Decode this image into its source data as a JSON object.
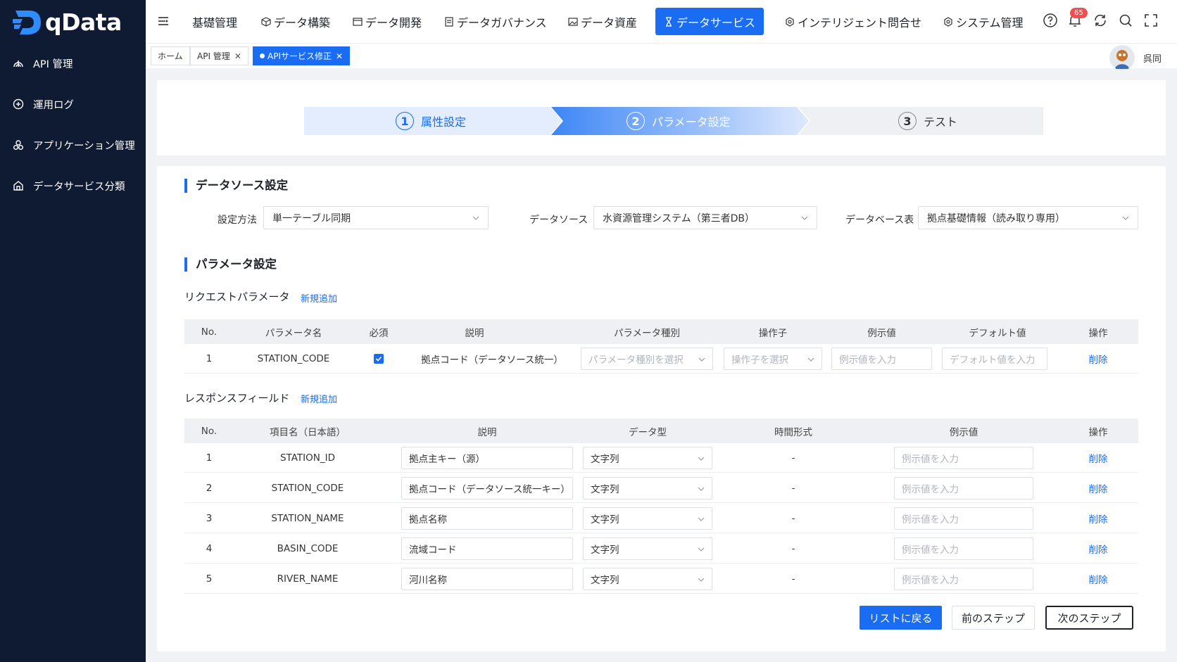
{
  "app": {
    "logo_text": "qData"
  },
  "sidebar": {
    "items": [
      {
        "label": "API 管理"
      },
      {
        "label": "運用ログ"
      },
      {
        "label": "アプリケーション管理"
      },
      {
        "label": "データサービス分類"
      }
    ]
  },
  "topnav": {
    "items": [
      {
        "label": "基礎管理"
      },
      {
        "label": "データ構築"
      },
      {
        "label": "データ開発"
      },
      {
        "label": "データガバナンス"
      },
      {
        "label": "データ資産"
      },
      {
        "label": "データサービス"
      },
      {
        "label": "インテリジェント問合せ"
      },
      {
        "label": "システム管理"
      }
    ],
    "active_index": 5,
    "notification_count": "65"
  },
  "tabs": [
    {
      "label": "ホーム"
    },
    {
      "label": "API 管理"
    },
    {
      "label": "APIサービス修正"
    }
  ],
  "user": {
    "name": "呉同"
  },
  "steps": [
    {
      "num": "1",
      "label": "属性設定"
    },
    {
      "num": "2",
      "label": "パラメータ設定"
    },
    {
      "num": "3",
      "label": "テスト"
    }
  ],
  "datasource": {
    "title": "データソース設定",
    "method_label": "設定方法",
    "method_value": "単一テーブル同期",
    "source_label": "データソース",
    "source_value": "水資源管理システム（第三者DB）",
    "table_label": "データベース表",
    "table_value": "拠点基礎情報（読み取り専用）"
  },
  "params": {
    "title": "パラメータ設定",
    "request": {
      "title": "リクエストパラメータ",
      "add_label": "新規追加",
      "headers": [
        "No.",
        "パラメータ名",
        "必須",
        "説明",
        "パラメータ種別",
        "操作子",
        "例示値",
        "デフォルト値",
        "操作"
      ],
      "rows": [
        {
          "no": "1",
          "name": "STATION_CODE",
          "desc": "拠点コード（データソース統一）",
          "type_ph": "パラメータ種別を選択",
          "op_ph": "操作子を選択",
          "example_ph": "例示値を入力",
          "default_ph": "デフォルト値を入力",
          "action": "削除"
        }
      ]
    },
    "response": {
      "title": "レスポンスフィールド",
      "add_label": "新規追加",
      "headers": [
        "No.",
        "項目名（日本語）",
        "説明",
        "データ型",
        "時間形式",
        "例示値",
        "操作"
      ],
      "rows": [
        {
          "no": "1",
          "name": "STATION_ID",
          "desc": "拠点主キー（源）",
          "type": "文字列",
          "time": "-",
          "example_ph": "例示値を入力",
          "action": "削除"
        },
        {
          "no": "2",
          "name": "STATION_CODE",
          "desc": "拠点コード（データソース統一キー）",
          "type": "文字列",
          "time": "-",
          "example_ph": "例示値を入力",
          "action": "削除"
        },
        {
          "no": "3",
          "name": "STATION_NAME",
          "desc": "拠点名称",
          "type": "文字列",
          "time": "-",
          "example_ph": "例示値を入力",
          "action": "削除"
        },
        {
          "no": "4",
          "name": "BASIN_CODE",
          "desc": "流域コード",
          "type": "文字列",
          "time": "-",
          "example_ph": "例示値を入力",
          "action": "削除"
        },
        {
          "no": "5",
          "name": "RIVER_NAME",
          "desc": "河川名称",
          "type": "文字列",
          "time": "-",
          "example_ph": "例示値を入力",
          "action": "削除"
        }
      ]
    }
  },
  "buttons": {
    "back": "リストに戻る",
    "prev": "前のステップ",
    "next": "次のステップ"
  },
  "colors": {
    "sidebar": "#0f1b33",
    "accent": "#1a6cf2"
  }
}
